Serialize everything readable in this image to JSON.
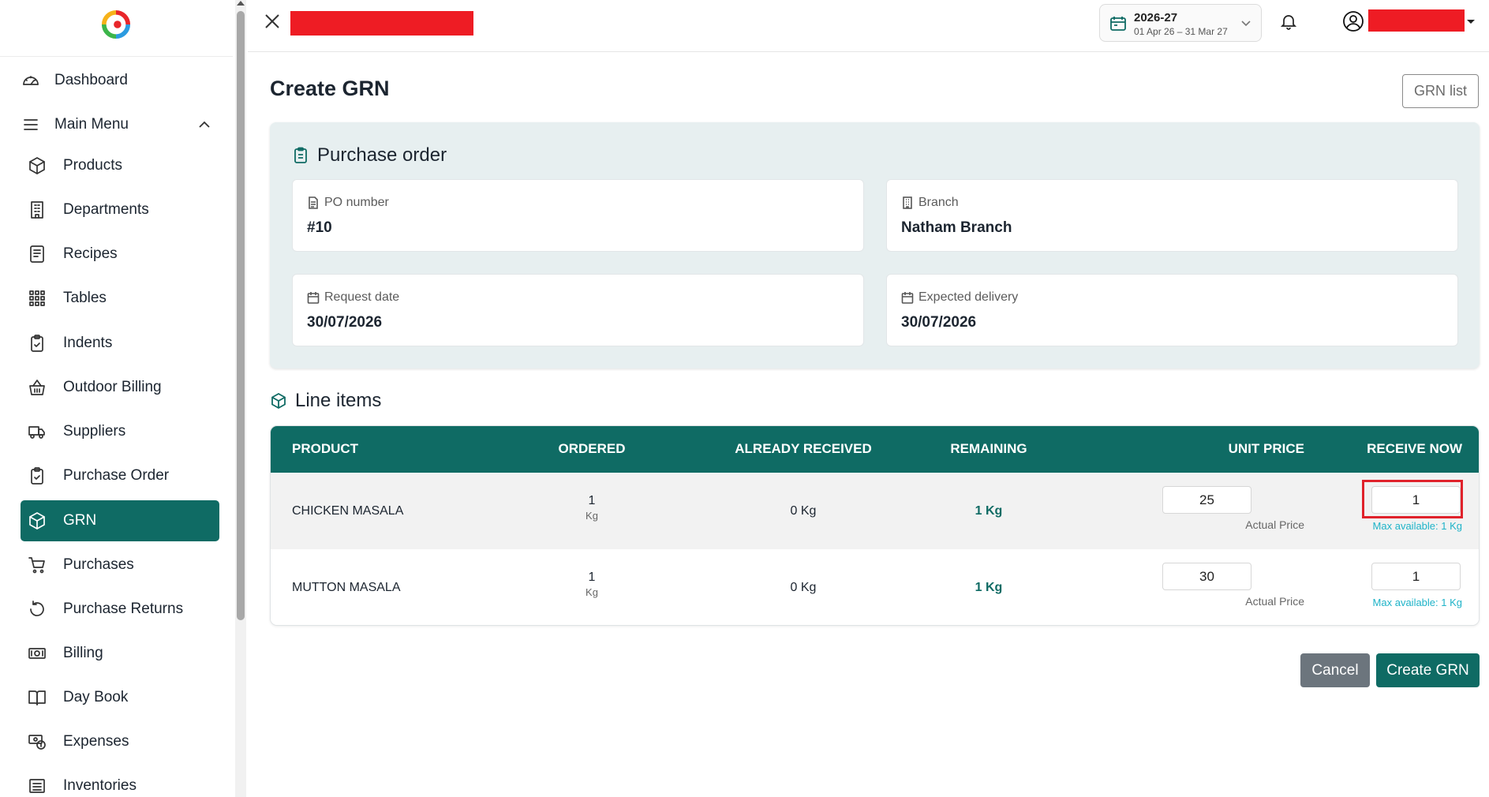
{
  "sidebar": {
    "top_items": [
      {
        "label": "Dashboard",
        "icon": "gauge-icon"
      },
      {
        "label": "Main Menu",
        "icon": "menu-icon"
      }
    ],
    "items": [
      {
        "label": "Products",
        "icon": "box-icon"
      },
      {
        "label": "Departments",
        "icon": "building-icon"
      },
      {
        "label": "Recipes",
        "icon": "document-list-icon"
      },
      {
        "label": "Tables",
        "icon": "grid-icon"
      },
      {
        "label": "Indents",
        "icon": "clipboard-check-icon"
      },
      {
        "label": "Outdoor Billing",
        "icon": "basket-icon"
      },
      {
        "label": "Suppliers",
        "icon": "truck-icon"
      },
      {
        "label": "Purchase Order",
        "icon": "clipboard-check-icon"
      },
      {
        "label": "GRN",
        "icon": "box-icon",
        "active": true
      },
      {
        "label": "Purchases",
        "icon": "cart-icon"
      },
      {
        "label": "Purchase Returns",
        "icon": "refresh-icon"
      },
      {
        "label": "Billing",
        "icon": "cash-icon"
      },
      {
        "label": "Day Book",
        "icon": "book-icon"
      },
      {
        "label": "Expenses",
        "icon": "money-icon"
      },
      {
        "label": "Inventories",
        "icon": "list-icon"
      }
    ]
  },
  "topbar": {
    "fiscal_year": "2026-27",
    "fiscal_range": "01 Apr 26 – 31 Mar 27"
  },
  "page": {
    "title": "Create GRN",
    "grn_list_label": "GRN list"
  },
  "purchase_order": {
    "title": "Purchase order",
    "po_number_label": "PO number",
    "po_number": "#10",
    "branch_label": "Branch",
    "branch": "Natham Branch",
    "request_date_label": "Request date",
    "request_date": "30/07/2026",
    "expected_delivery_label": "Expected delivery",
    "expected_delivery": "30/07/2026"
  },
  "line_items": {
    "title": "Line items",
    "headers": [
      "PRODUCT",
      "ORDERED",
      "ALREADY RECEIVED",
      "REMAINING",
      "UNIT PRICE",
      "RECEIVE NOW"
    ],
    "rows": [
      {
        "product": "CHICKEN MASALA",
        "ordered": "1",
        "ordered_unit": "Kg",
        "already_received": "0 Kg",
        "remaining": "1 Kg",
        "unit_price": "25",
        "unit_price_hint": "Actual Price",
        "receive_now": "1",
        "receive_hint": "Max available: 1 Kg"
      },
      {
        "product": "MUTTON MASALA",
        "ordered": "1",
        "ordered_unit": "Kg",
        "already_received": "0 Kg",
        "remaining": "1 Kg",
        "unit_price": "30",
        "unit_price_hint": "Actual Price",
        "receive_now": "1",
        "receive_hint": "Max available: 1 Kg"
      }
    ]
  },
  "actions": {
    "cancel": "Cancel",
    "create": "Create GRN"
  },
  "colors": {
    "primary": "#0f6b64",
    "panel": "#e7eff0",
    "hint": "#1fb3c8",
    "highlight": "#e0222b",
    "redaction": "#ee1c24"
  }
}
